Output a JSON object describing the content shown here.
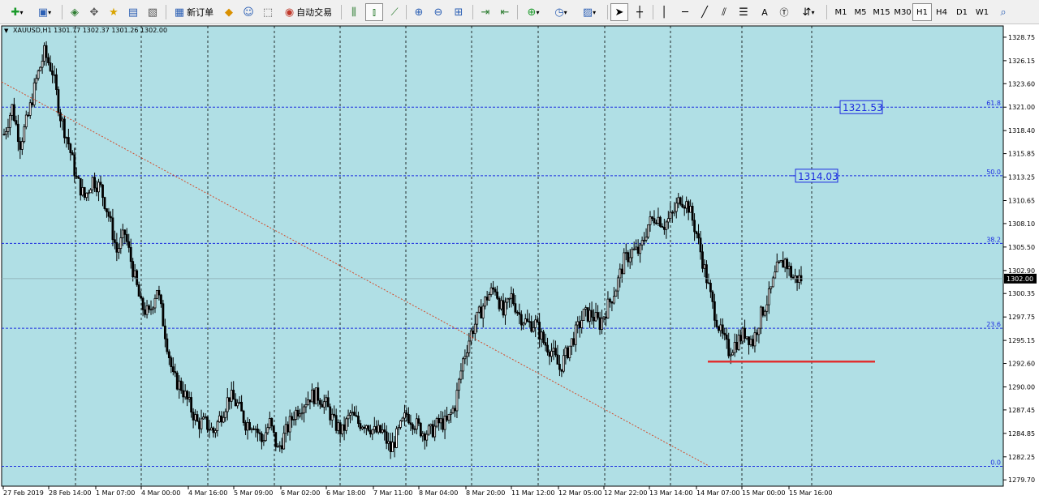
{
  "toolbar": {
    "new_order_label": "新订单",
    "auto_trading_label": "自动交易",
    "timeframes": [
      "M1",
      "M5",
      "M15",
      "M30",
      "H1",
      "H4",
      "D1",
      "W1"
    ],
    "active_timeframe": "H1"
  },
  "chart": {
    "header": "XAUUSD,H1  1301.77 1302.37 1301.26 1302.00",
    "current_price_label": "1302.00",
    "background": "#b0dfe5"
  },
  "chart_data": {
    "type": "candlestick",
    "symbol": "XAUUSD",
    "timeframe": "H1",
    "ohlc_last": {
      "open": 1301.77,
      "high": 1302.37,
      "low": 1301.26,
      "close": 1302.0
    },
    "ylim": [
      1279.0,
      1330.0
    ],
    "y_ticks": [
      "1328.75",
      "1326.15",
      "1323.60",
      "1321.00",
      "1318.40",
      "1315.85",
      "1313.25",
      "1310.65",
      "1308.10",
      "1305.50",
      "1302.90",
      "1300.35",
      "1297.75",
      "1295.15",
      "1292.60",
      "1290.00",
      "1287.45",
      "1284.85",
      "1282.25",
      "1279.70"
    ],
    "x_ticks": [
      "27 Feb 2019",
      "28 Feb 14:00",
      "1 Mar 07:00",
      "4 Mar 00:00",
      "4 Mar 16:00",
      "5 Mar 09:00",
      "6 Mar 02:00",
      "6 Mar 18:00",
      "7 Mar 11:00",
      "8 Mar 04:00",
      "8 Mar 20:00",
      "11 Mar 12:00",
      "12 Mar 05:00",
      "12 Mar 22:00",
      "13 Mar 14:00",
      "14 Mar 07:00",
      "15 Mar 00:00",
      "15 Mar 16:00"
    ],
    "fib_levels": [
      {
        "label": "61.8",
        "price": 1321.0
      },
      {
        "label": "50.0",
        "price": 1313.4
      },
      {
        "label": "38.2",
        "price": 1305.9
      },
      {
        "label": "23.6",
        "price": 1296.5
      },
      {
        "label": "0.0",
        "price": 1281.2
      }
    ],
    "price_tags": [
      "1321.53",
      "1314.03"
    ],
    "trend_line": {
      "from_price": 1323.8,
      "to_price": 1281.3
    },
    "support_line_price": 1292.8,
    "close_path": [
      1318,
      1321,
      1317,
      1320,
      1324,
      1327,
      1325,
      1320,
      1317,
      1313,
      1311,
      1313,
      1312,
      1309,
      1305,
      1307,
      1303,
      1299,
      1298,
      1301,
      1296,
      1291,
      1290,
      1288,
      1286,
      1286,
      1285,
      1287,
      1289,
      1288,
      1286,
      1286,
      1284,
      1286,
      1283,
      1285,
      1287,
      1288,
      1289,
      1289,
      1288,
      1286,
      1285,
      1287,
      1286,
      1286,
      1285,
      1285,
      1283,
      1285,
      1287,
      1286,
      1285,
      1285,
      1286,
      1286,
      1288,
      1293,
      1296,
      1298,
      1300,
      1301,
      1298,
      1300,
      1298,
      1297,
      1297,
      1295,
      1294,
      1292,
      1294,
      1296,
      1298,
      1298,
      1297,
      1299,
      1301,
      1304,
      1305,
      1305,
      1308,
      1309,
      1308,
      1309,
      1311,
      1310,
      1307,
      1303,
      1299,
      1296,
      1294,
      1295,
      1296,
      1295,
      1298,
      1300,
      1303,
      1304,
      1302,
      1302
    ]
  }
}
